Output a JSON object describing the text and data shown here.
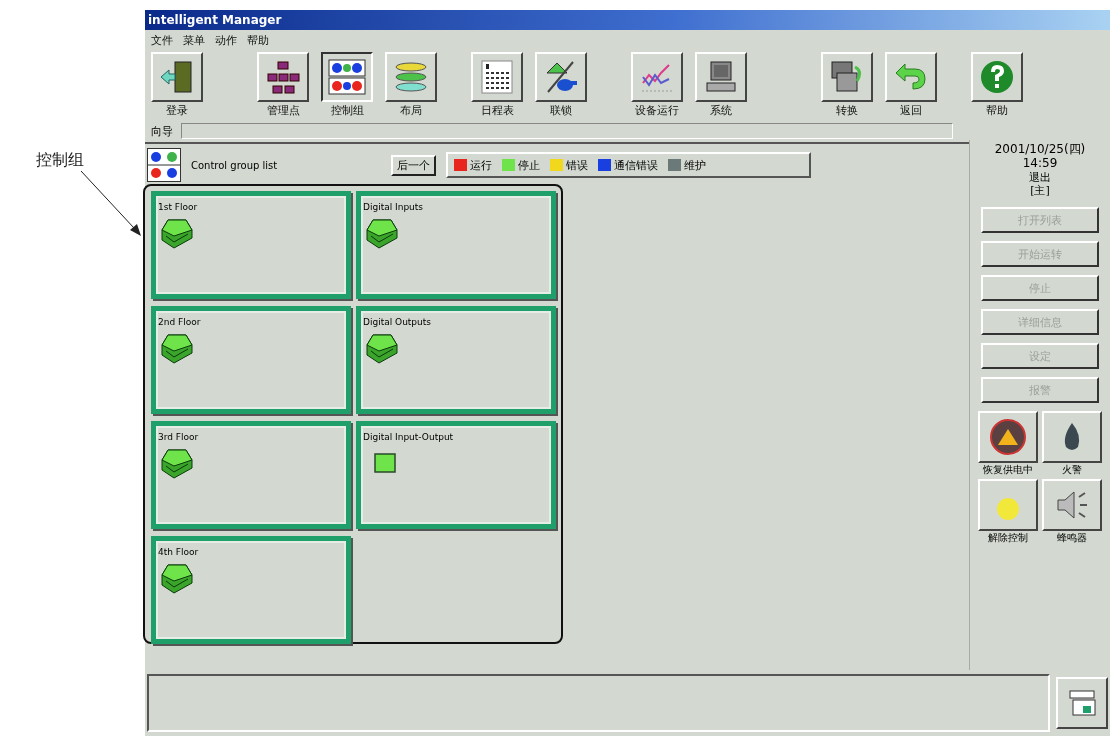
{
  "annotation": {
    "label": "控制组"
  },
  "window": {
    "title": "intelligent Manager"
  },
  "menu": [
    "文件",
    "菜单",
    "动作",
    "帮助"
  ],
  "toolbar_groups": [
    {
      "buttons": [
        {
          "label": "登录",
          "selected": false
        }
      ]
    },
    {
      "buttons": [
        {
          "label": "管理点",
          "selected": false
        },
        {
          "label": "控制组",
          "selected": true
        },
        {
          "label": "布局",
          "selected": false
        }
      ]
    },
    {
      "buttons": [
        {
          "label": "日程表",
          "selected": false
        },
        {
          "label": "联锁",
          "selected": false
        }
      ]
    },
    {
      "buttons": [
        {
          "label": "设备运行",
          "selected": false
        },
        {
          "label": "系统",
          "selected": false
        }
      ]
    },
    {
      "buttons": [
        {
          "label": "转换",
          "selected": false
        },
        {
          "label": "返回",
          "selected": false
        }
      ]
    },
    {
      "buttons": [
        {
          "label": "帮助",
          "selected": false
        }
      ]
    }
  ],
  "guide": {
    "label": "向导"
  },
  "panel": {
    "title": "Control group list",
    "next_button": "后一个"
  },
  "legend": [
    {
      "label": "运行",
      "color": "#e8261e"
    },
    {
      "label": "停止",
      "color": "#6fe34a"
    },
    {
      "label": "错误",
      "color": "#f2d81c"
    },
    {
      "label": "通信错误",
      "color": "#1a3fe0"
    },
    {
      "label": "维护",
      "color": "#6b7a78"
    }
  ],
  "groups": [
    {
      "name": "1st Floor",
      "kind": "unit",
      "color": "#1fa06a"
    },
    {
      "name": "Digital Inputs",
      "kind": "unit",
      "color": "#1fa06a"
    },
    {
      "name": "2nd Floor",
      "kind": "unit",
      "color": "#1fa06a"
    },
    {
      "name": "Digital Outputs",
      "kind": "unit",
      "color": "#1fa06a"
    },
    {
      "name": "3rd Floor",
      "kind": "unit",
      "color": "#1fa06a"
    },
    {
      "name": "Digital Input-Output",
      "kind": "point",
      "color": "#1fa06a"
    },
    {
      "name": "4th Floor",
      "kind": "unit",
      "color": "#1fa06a"
    }
  ],
  "clock": {
    "date": "2001/10/25(四)",
    "time": "14:59",
    "logout": "退出",
    "user": "[主]"
  },
  "side_buttons": [
    {
      "label": "打开列表",
      "disabled": true
    },
    {
      "label": "开始运转",
      "disabled": true
    },
    {
      "label": "停止",
      "disabled": true
    },
    {
      "label": "详细信息",
      "disabled": true
    },
    {
      "label": "设定",
      "disabled": true
    },
    {
      "label": "报警",
      "disabled": true
    }
  ],
  "alarm_buttons": [
    {
      "label": "恢复供电中"
    },
    {
      "label": "火警"
    },
    {
      "label": "解除控制"
    },
    {
      "label": "蜂鸣器"
    }
  ]
}
